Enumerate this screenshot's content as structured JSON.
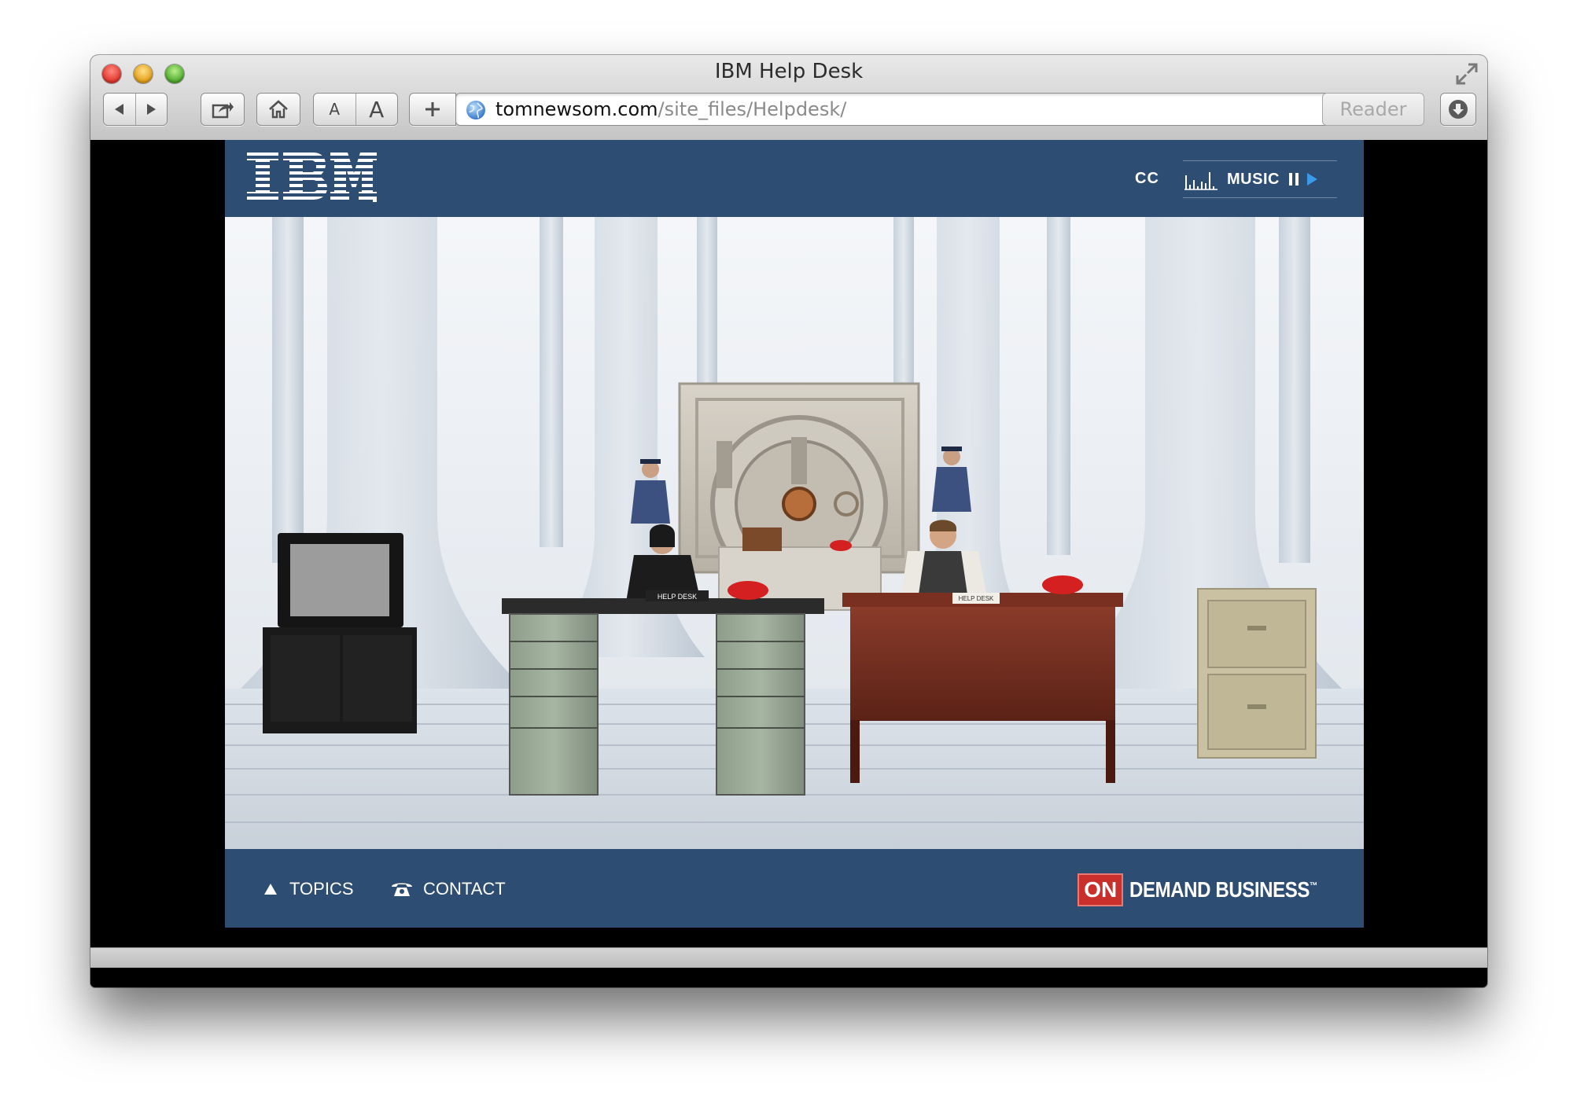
{
  "window": {
    "title": "IBM Help Desk"
  },
  "toolbar": {
    "back_icon": "back-arrow-icon",
    "forward_icon": "forward-arrow-icon",
    "text_smaller": "A",
    "text_larger": "A",
    "add_icon": "plus-icon",
    "reader_label": "Reader"
  },
  "address": {
    "domain": "tomnewsom.com",
    "path": "/site_files/Helpdesk/"
  },
  "site": {
    "header": {
      "cc_label": "CC",
      "music_label": "MUSIC"
    },
    "footer": {
      "topics_label": "TOPICS",
      "contact_label": "CONTACT",
      "brand_on": "ON",
      "brand_text": "DEMAND BUSINESS",
      "brand_tm": "™"
    },
    "scene": {
      "desk_sign_left": "HELP DESK",
      "desk_sign_right": "HELP DESK"
    }
  },
  "colors": {
    "site_blue": "#2d4d73",
    "on_red": "#c9302c",
    "play_blue": "#3a9be8"
  }
}
